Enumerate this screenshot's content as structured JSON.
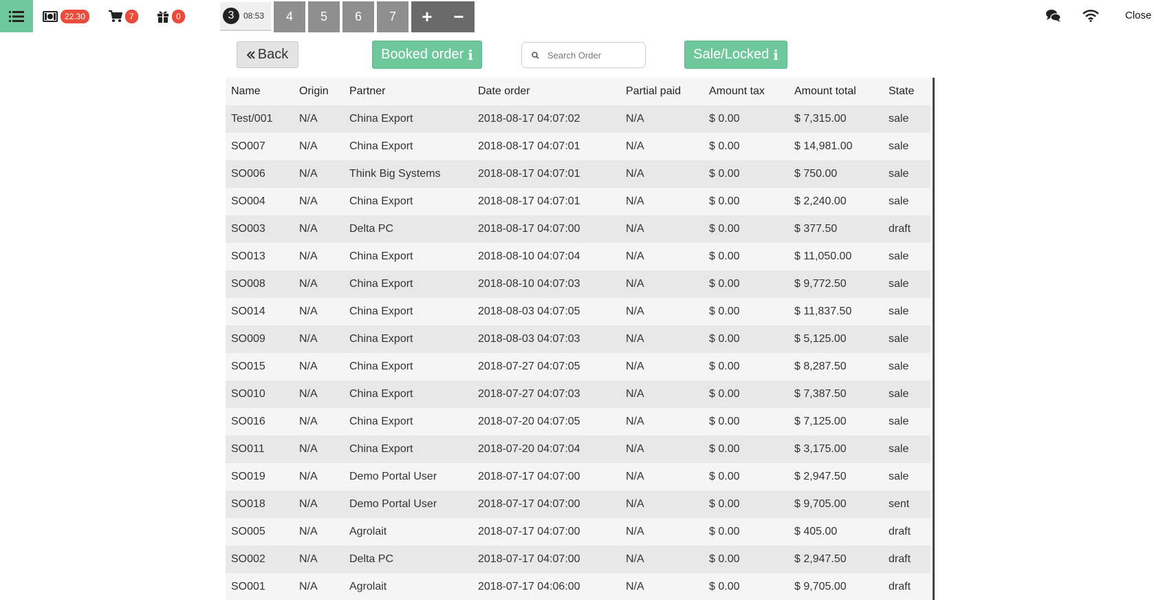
{
  "header": {
    "cash_badge": "22.30",
    "cart_badge": "7",
    "gift_badge": "0",
    "current_order": {
      "number": "3",
      "time": "08:53"
    },
    "order_tabs": [
      "4",
      "5",
      "6",
      "7"
    ],
    "add_label": "+",
    "remove_label": "−",
    "close_label": "Close"
  },
  "toolbar": {
    "back_label": "Back",
    "booked_label": "Booked order",
    "search_placeholder": "Search Order",
    "sale_locked_label": "Sale/Locked"
  },
  "table": {
    "columns": [
      "Name",
      "Origin",
      "Partner",
      "Date order",
      "Partial paid",
      "Amount tax",
      "Amount total",
      "State"
    ],
    "rows": [
      [
        "Test/001",
        "N/A",
        "China Export",
        "2018-08-17 04:07:02",
        "N/A",
        "$ 0.00",
        "$ 7,315.00",
        "sale"
      ],
      [
        "SO007",
        "N/A",
        "China Export",
        "2018-08-17 04:07:01",
        "N/A",
        "$ 0.00",
        "$ 14,981.00",
        "sale"
      ],
      [
        "SO006",
        "N/A",
        "Think Big Systems",
        "2018-08-17 04:07:01",
        "N/A",
        "$ 0.00",
        "$ 750.00",
        "sale"
      ],
      [
        "SO004",
        "N/A",
        "China Export",
        "2018-08-17 04:07:01",
        "N/A",
        "$ 0.00",
        "$ 2,240.00",
        "sale"
      ],
      [
        "SO003",
        "N/A",
        "Delta PC",
        "2018-08-17 04:07:00",
        "N/A",
        "$ 0.00",
        "$ 377.50",
        "draft"
      ],
      [
        "SO013",
        "N/A",
        "China Export",
        "2018-08-10 04:07:04",
        "N/A",
        "$ 0.00",
        "$ 11,050.00",
        "sale"
      ],
      [
        "SO008",
        "N/A",
        "China Export",
        "2018-08-10 04:07:03",
        "N/A",
        "$ 0.00",
        "$ 9,772.50",
        "sale"
      ],
      [
        "SO014",
        "N/A",
        "China Export",
        "2018-08-03 04:07:05",
        "N/A",
        "$ 0.00",
        "$ 11,837.50",
        "sale"
      ],
      [
        "SO009",
        "N/A",
        "China Export",
        "2018-08-03 04:07:03",
        "N/A",
        "$ 0.00",
        "$ 5,125.00",
        "sale"
      ],
      [
        "SO015",
        "N/A",
        "China Export",
        "2018-07-27 04:07:05",
        "N/A",
        "$ 0.00",
        "$ 8,287.50",
        "sale"
      ],
      [
        "SO010",
        "N/A",
        "China Export",
        "2018-07-27 04:07:03",
        "N/A",
        "$ 0.00",
        "$ 7,387.50",
        "sale"
      ],
      [
        "SO016",
        "N/A",
        "China Export",
        "2018-07-20 04:07:05",
        "N/A",
        "$ 0.00",
        "$ 7,125.00",
        "sale"
      ],
      [
        "SO011",
        "N/A",
        "China Export",
        "2018-07-20 04:07:04",
        "N/A",
        "$ 0.00",
        "$ 3,175.00",
        "sale"
      ],
      [
        "SO019",
        "N/A",
        "Demo Portal User",
        "2018-07-17 04:07:00",
        "N/A",
        "$ 0.00",
        "$ 2,947.50",
        "sale"
      ],
      [
        "SO018",
        "N/A",
        "Demo Portal User",
        "2018-07-17 04:07:00",
        "N/A",
        "$ 0.00",
        "$ 9,705.00",
        "sent"
      ],
      [
        "SO005",
        "N/A",
        "Agrolait",
        "2018-07-17 04:07:00",
        "N/A",
        "$ 0.00",
        "$ 405.00",
        "draft"
      ],
      [
        "SO002",
        "N/A",
        "Delta PC",
        "2018-07-17 04:07:00",
        "N/A",
        "$ 0.00",
        "$ 2,947.50",
        "draft"
      ],
      [
        "SO001",
        "N/A",
        "Agrolait",
        "2018-07-17 04:06:00",
        "N/A",
        "$ 0.00",
        "$ 9,705.00",
        "draft"
      ]
    ]
  },
  "colors": {
    "accent": "#6ec89b",
    "badge": "#e74c3c",
    "tab": "#8f8f8f"
  },
  "icons": [
    "list-icon",
    "cash-icon",
    "cart-icon",
    "gift-icon",
    "chat-icon",
    "wifi-icon",
    "search-icon",
    "double-chevron-left-icon",
    "info-icon"
  ]
}
